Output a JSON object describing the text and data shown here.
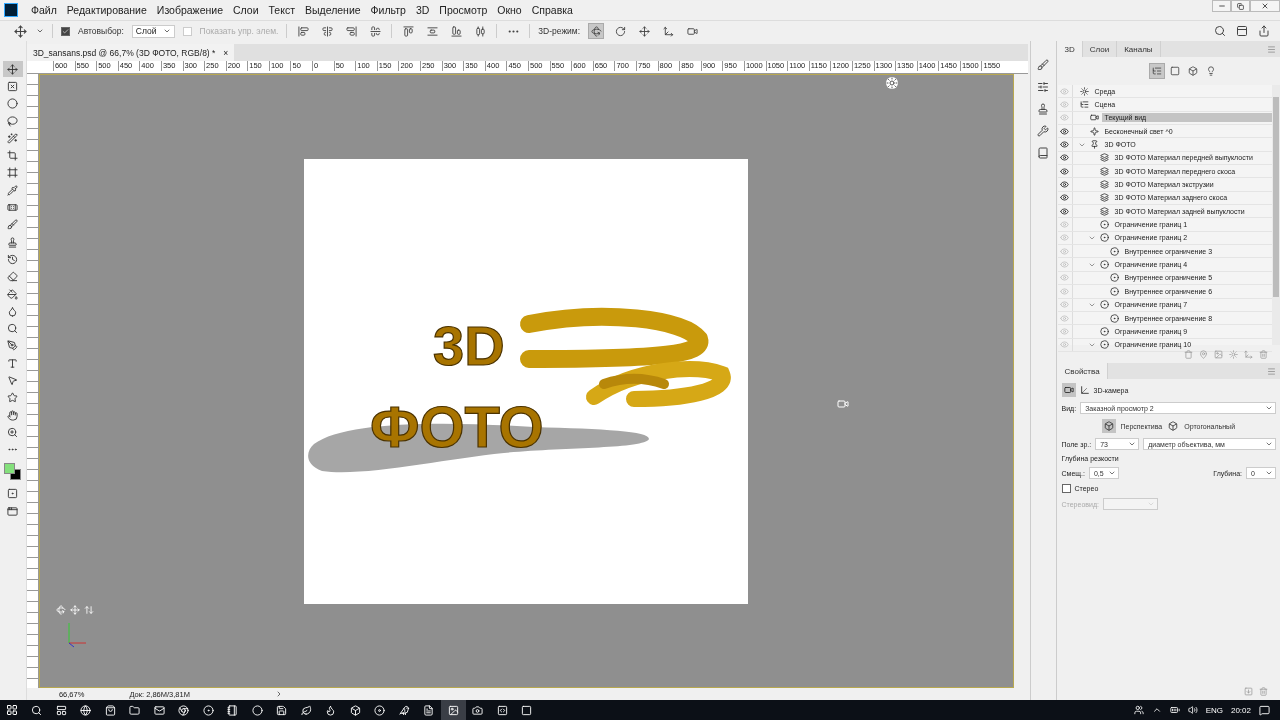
{
  "menu_bar": {
    "items": [
      "Файл",
      "Редактирование",
      "Изображение",
      "Слои",
      "Текст",
      "Выделение",
      "Фильтр",
      "3D",
      "Просмотр",
      "Окно",
      "Справка"
    ]
  },
  "options_bar": {
    "auto_select": {
      "label": "Автовыбор:",
      "checked": true
    },
    "auto_select_target": "Слой",
    "show_controls": {
      "label": "Показать упр. элем.",
      "checked": false,
      "disabled": true
    },
    "mode_label": "3D-режим:"
  },
  "tools": [
    {
      "selected": true
    },
    {
      "selected": false
    },
    {
      "selected": false
    },
    {
      "selected": false
    },
    {
      "selected": false
    },
    {
      "selected": false
    },
    {
      "selected": false
    },
    {
      "selected": false
    },
    {
      "selected": false
    },
    {
      "selected": false
    },
    {
      "selected": false
    },
    {
      "selected": false
    },
    {
      "selected": false
    },
    {
      "selected": false
    },
    {
      "selected": false
    },
    {
      "selected": false
    },
    {
      "selected": false
    },
    {
      "selected": false
    },
    {
      "selected": false
    },
    {
      "selected": false
    },
    {
      "selected": false
    },
    {
      "selected": false
    },
    {
      "selected": false
    }
  ],
  "swatches": [
    {
      "color": "#84e07c"
    },
    {
      "color": "#000000"
    }
  ],
  "document": {
    "tab_title": "3D_sansans.psd @ 66,7% (3D ФОТО, RGB/8) *",
    "close": "×",
    "ruler_labels": [
      "600",
      "550",
      "500",
      "450",
      "400",
      "350",
      "300",
      "250",
      "200",
      "150",
      "100",
      "50",
      "0",
      "50",
      "100",
      "150",
      "200",
      "250",
      "300",
      "350",
      "400",
      "450",
      "500",
      "550",
      "600",
      "650",
      "700",
      "750",
      "800",
      "850",
      "900",
      "950",
      "1000",
      "1050",
      "1100",
      "1150",
      "1200",
      "1250",
      "1300",
      "1350",
      "1400",
      "1450",
      "1500",
      "1550"
    ],
    "artwork": [
      "3D",
      "ФОТО"
    ]
  },
  "status_bar": {
    "zoom": "66,67%",
    "doc_size": "Док: 2,86M/3,81M"
  },
  "panel_3d": {
    "tabs": [
      {
        "label": "3D",
        "selected": true
      },
      {
        "label": "Слои",
        "selected": false
      },
      {
        "label": "Каналы",
        "selected": false
      }
    ],
    "filters": [
      {
        "selected": true
      },
      {
        "selected": false
      },
      {
        "selected": false
      },
      {
        "selected": false
      }
    ],
    "tree": [
      {
        "label": "Среда",
        "kind": "environment",
        "visible": false,
        "selected": false
      },
      {
        "label": "Сцена",
        "kind": "scene",
        "visible": false,
        "selected": false,
        "children": [
          {
            "label": "Текущий вид",
            "kind": "camera",
            "visible": false,
            "selected": true
          },
          {
            "label": "Бесконечный свет ^0",
            "kind": "light",
            "visible": true,
            "selected": false
          },
          {
            "label": "3D ФОТО",
            "kind": "mesh",
            "visible": true,
            "selected": false,
            "expanded": true,
            "children": [
              {
                "label": "3D ФОТО Материал передней выпуклости",
                "kind": "material",
                "visible": true,
                "selected": false
              },
              {
                "label": "3D ФОТО Материал переднего скоса",
                "kind": "material",
                "visible": true,
                "selected": false
              },
              {
                "label": "3D ФОТО Материал экструзии",
                "kind": "material",
                "visible": true,
                "selected": false
              },
              {
                "label": "3D ФОТО Материал заднего скоса",
                "kind": "material",
                "visible": true,
                "selected": false
              },
              {
                "label": "3D ФОТО Материал задней выпуклости",
                "kind": "material",
                "visible": true,
                "selected": false
              },
              {
                "label": "Ограничение границ 1",
                "kind": "constraint",
                "visible": false,
                "selected": false
              },
              {
                "label": "Ограничение границ 2",
                "kind": "constraint",
                "visible": false,
                "selected": false,
                "expanded": true,
                "children": [
                  {
                    "label": "Внутреннее ограничение 3",
                    "kind": "constraint",
                    "visible": false,
                    "selected": false
                  }
                ]
              },
              {
                "label": "Ограничение границ 4",
                "kind": "constraint",
                "visible": false,
                "selected": false,
                "expanded": true,
                "children": [
                  {
                    "label": "Внутреннее ограничение 5",
                    "kind": "constraint",
                    "visible": false,
                    "selected": false
                  },
                  {
                    "label": "Внутреннее ограничение 6",
                    "kind": "constraint",
                    "visible": false,
                    "selected": false
                  }
                ]
              },
              {
                "label": "Ограничение границ 7",
                "kind": "constraint",
                "visible": false,
                "selected": false,
                "expanded": true,
                "children": [
                  {
                    "label": "Внутреннее ограничение 8",
                    "kind": "constraint",
                    "visible": false,
                    "selected": false
                  }
                ]
              },
              {
                "label": "Ограничение границ 9",
                "kind": "constraint",
                "visible": false,
                "selected": false
              },
              {
                "label": "Ограничение границ 10",
                "kind": "constraint",
                "visible": false,
                "selected": false,
                "expanded": true
              }
            ]
          }
        ]
      }
    ]
  },
  "properties": {
    "tab": "Свойства",
    "heading": "3D-камера",
    "view_label": "Вид:",
    "view_value": "Заказной просмотр 2",
    "projection": [
      {
        "label": "Перспектива",
        "selected": true
      },
      {
        "label": "Ортогональный",
        "selected": false
      }
    ],
    "fov_label": "Поле зр.:",
    "fov_value": "73",
    "fov_unit": "диаметр объектива, мм",
    "dof_label": "Глубина резкости",
    "offset_label": "Смещ.:",
    "offset_value": "0,5",
    "depth_label": "Глубина:",
    "depth_value": "0",
    "stereo": {
      "label": "Стерео",
      "checked": false
    },
    "stereo_view_label": "Стереовид:"
  },
  "taskbar": {
    "language": "ENG",
    "time": "20:02"
  }
}
